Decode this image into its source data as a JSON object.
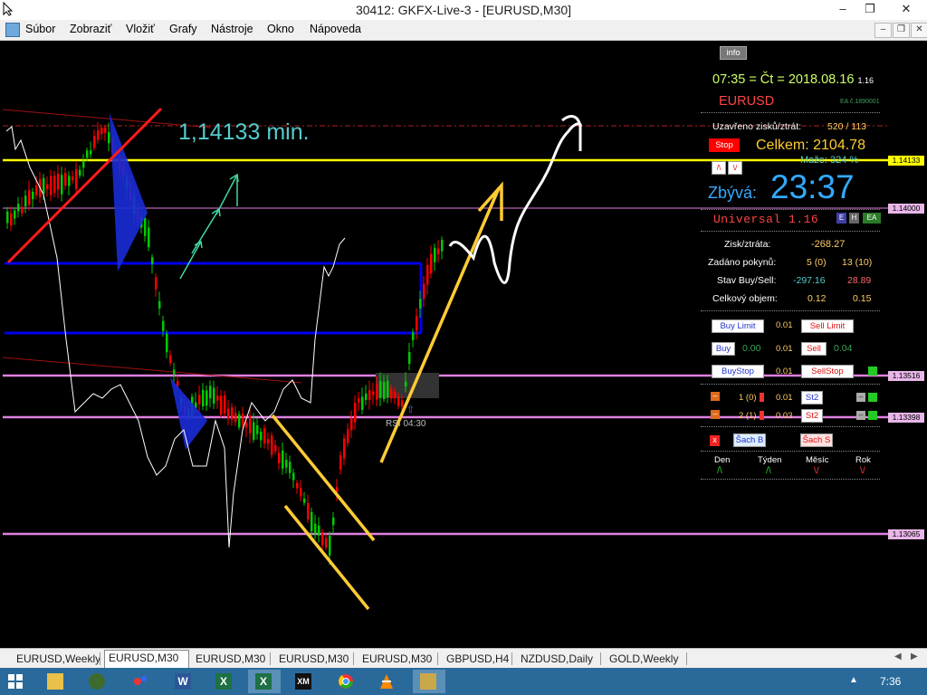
{
  "window": {
    "title": "30412: GKFX-Live-3 - [EURUSD,M30]",
    "minimize": "–",
    "restore": "❐",
    "close": "✕"
  },
  "menu": {
    "items": [
      "Súbor",
      "Zobraziť",
      "Vložiť",
      "Grafy",
      "Nástroje",
      "Okno",
      "Nápoveda"
    ]
  },
  "chart": {
    "annotation_text": "1,14133 min.",
    "rsi_label": "RSI 04:30",
    "price_tags": [
      "1.14133",
      "1.14000",
      "1.13516",
      "1.13398",
      "1.13065"
    ],
    "colors": {
      "background": "#000000",
      "yellow_line": "#ffff00",
      "blue_line": "#0000ff",
      "pink_line": "#e080e0",
      "bull": "#00cc00",
      "bear": "#ff0000",
      "annotation": "#55cccc"
    }
  },
  "panel": {
    "info_button": "info",
    "clock": "07:35 = Čt = 2018.08.16",
    "clock_suffix": "1.16",
    "symbol": "EURUSD",
    "ea_tag": "EA č.1890001",
    "closed_pl_label": "Uzavřeno zisků/ztrát:",
    "closed_pl_value": "520 / 113",
    "stop_button": "Stop",
    "total": "Celkem: 2104.78",
    "arrow_buttons": [
      "/\\",
      "\\/"
    ],
    "delete_label": "Maže:",
    "delete_value": "324 %",
    "remaining_label": "Zbývá:",
    "remaining_time": "23:37",
    "strategy_name": "Universal 1.16",
    "strategy_badges": [
      "E",
      "H",
      "EA"
    ],
    "profit_loss_label": "Zisk/ztráta:",
    "profit_loss_value": "-268.27",
    "orders_label": "Zadáno pokynů:",
    "orders_buy": "5 (0)",
    "orders_sell": "13 (10)",
    "state_label": "Stav Buy/Sell:",
    "state_buy": "-297.16",
    "state_sell": "28.89",
    "volume_label": "Celkový objem:",
    "volume_buy": "0.12",
    "volume_sell": "0.15",
    "buy_limit": "Buy Limit",
    "sell_limit": "Sell Limit",
    "lot_1": "0.01",
    "buy": "Buy",
    "buy_price": "0.00",
    "lot_2": "0.01",
    "sell": "Sell",
    "sell_price": "0.04",
    "buy_stop": "BuyStop",
    "lot_3": "0.01",
    "sell_stop": "SellStop",
    "row1_count": "1 (0)",
    "row1_lot": "0.01",
    "row1_btn": "St2",
    "row2_count": "2 (1)",
    "row2_lot": "0.03",
    "row2_btn": "St2",
    "x_button": "x",
    "sach_b": "Šach B",
    "sach_s": "Šach S",
    "periods": [
      {
        "label": "Den",
        "dir": "/\\"
      },
      {
        "label": "Týden",
        "dir": "/\\"
      },
      {
        "label": "Měsíc",
        "dir": "\\/"
      },
      {
        "label": "Rok",
        "dir": "\\/"
      }
    ]
  },
  "tabs": {
    "items": [
      "EURUSD,Weekly",
      "EURUSD,M30",
      "EURUSD,M30",
      "EURUSD,M30",
      "EURUSD,M30",
      "GBPUSD,H4",
      "NZDUSD,Daily",
      "GOLD,Weekly"
    ],
    "active_index": 1
  },
  "taskbar": {
    "apps": [
      "folder",
      "mt4-globe",
      "paint",
      "W",
      "X",
      "X",
      "XM",
      "chrome",
      "vlc",
      "mt4"
    ],
    "clock": "7:36"
  }
}
